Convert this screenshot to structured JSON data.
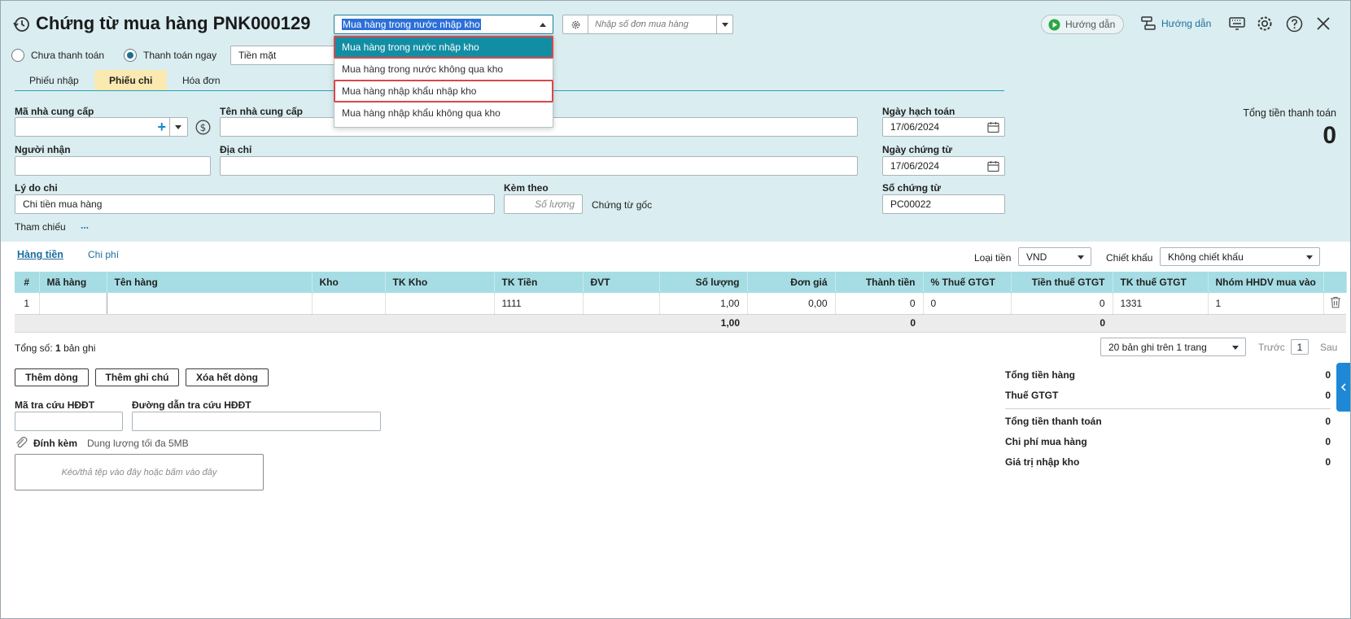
{
  "header": {
    "title": "Chứng từ mua hàng PNK000129",
    "voucher_type_value": "Mua hàng trong nước nhập kho",
    "order_search_placeholder": "Nhập số đơn mua hàng",
    "guide_button_1": "Hướng dẫn",
    "guide_button_2": "Hướng dẫn"
  },
  "voucher_type_options": [
    "Mua hàng trong nước nhập kho",
    "Mua hàng trong nước không qua kho",
    "Mua hàng nhập khẩu nhập kho",
    "Mua hàng nhập khẩu không qua kho"
  ],
  "payment": {
    "option_unpaid": "Chưa thanh toán",
    "option_paid_now": "Thanh toán ngay",
    "method_value": "Tiền mặt"
  },
  "tabs": [
    "Phiếu nhập",
    "Phiếu chi",
    "Hóa đơn"
  ],
  "form": {
    "supplier_code_label": "Mã nhà cung cấp",
    "supplier_name_label": "Tên nhà cung cấp",
    "receiver_label": "Người nhận",
    "address_label": "Địa chỉ",
    "reason_label": "Lý do chi",
    "reason_value": "Chi tiền mua hàng",
    "attach_label": "Kèm theo",
    "attach_qty_placeholder": "Số lượng",
    "attach_suffix": "Chứng từ gốc",
    "reference_label": "Tham chiếu",
    "reference_link": "...",
    "posting_date_label": "Ngày hạch toán",
    "posting_date_value": "17/06/2024",
    "voucher_date_label": "Ngày chứng từ",
    "voucher_date_value": "17/06/2024",
    "voucher_no_label": "Số chứng từ",
    "voucher_no_value": "PC00022",
    "total_payment_label": "Tổng tiền thanh toán",
    "total_payment_value": "0"
  },
  "detail_tabs": [
    "Hàng tiền",
    "Chi phí"
  ],
  "currency": {
    "label": "Loại tiền",
    "value": "VND"
  },
  "discount": {
    "label": "Chiết khấu",
    "value": "Không chiết khấu"
  },
  "table": {
    "columns": [
      "#",
      "Mã hàng",
      "Tên hàng",
      "Kho",
      "TK Kho",
      "TK Tiền",
      "ĐVT",
      "Số lượng",
      "Đơn giá",
      "Thành tiền",
      "% Thuế GTGT",
      "Tiền thuế GTGT",
      "TK thuế GTGT",
      "Nhóm HHDV mua vào"
    ],
    "rows": [
      [
        "1",
        "",
        "",
        "",
        "",
        "1111",
        "",
        "1,00",
        "0,00",
        "0",
        "0",
        "0",
        "1331",
        "1"
      ]
    ],
    "summary": {
      "qty": "1,00",
      "amount": "0",
      "tax": "0"
    }
  },
  "pagination": {
    "total_prefix": "Tổng số:",
    "total_count": "1",
    "total_suffix": "bản ghi",
    "page_size_value": "20 bản ghi trên 1 trang",
    "prev": "Trước",
    "page": "1",
    "next": "Sau"
  },
  "actions": {
    "add_row": "Thêm dòng",
    "add_note": "Thêm ghi chú",
    "delete_all": "Xóa hết dòng"
  },
  "einvoice": {
    "lookup_code_label": "Mã tra cứu HĐĐT",
    "lookup_url_label": "Đường dẫn tra cứu HĐĐT"
  },
  "attachment": {
    "label": "Đính kèm",
    "hint": "Dung lượng tối đa 5MB",
    "drop_text": "Kéo/thả tệp vào đây hoặc bấm vào đây"
  },
  "totals": [
    {
      "label": "Tổng tiền hàng",
      "value": "0"
    },
    {
      "label": "Thuế GTGT",
      "value": "0"
    },
    {
      "label": "Tổng tiền thanh toán",
      "value": "0"
    },
    {
      "label": "Chi phí mua hàng",
      "value": "0"
    },
    {
      "label": "Giá trị nhập kho",
      "value": "0"
    }
  ],
  "colors": {
    "accent": "#128ea4",
    "header_bg": "#daedf0",
    "table_header": "#a6dde4",
    "active_tab": "#fae9b0",
    "highlight": "#d9474b",
    "side_tab": "#1e88d6"
  }
}
